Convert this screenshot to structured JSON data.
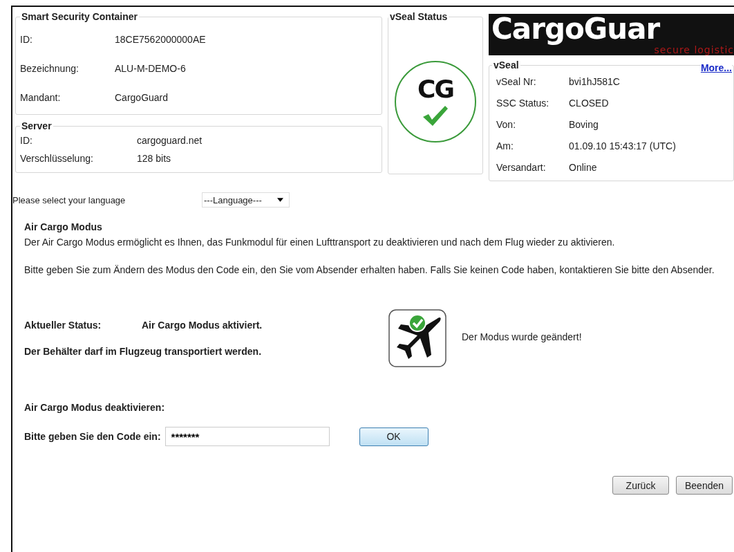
{
  "containers": [
    {
      "title": "Smart Security Container",
      "kind": "wide",
      "rows": [
        {
          "label": "ID:",
          "value": "18CE7562000000AE"
        },
        {
          "label": "Bezeichnung:",
          "value": "ALU-M-DEMO-6"
        },
        {
          "label": "Mandant:",
          "value": "CargoGuard"
        }
      ]
    },
    {
      "title": "Server",
      "kind": "compact",
      "rows": [
        {
          "label": "ID:",
          "value": "cargoguard.net"
        },
        {
          "label": "Verschlüsselung:",
          "value": "128 bits"
        }
      ]
    }
  ],
  "vseal_status": {
    "title": "vSeal Status",
    "badge": "CG",
    "verified": true
  },
  "logo": {
    "name": "CargoGuar",
    "tagline": "secure logistic"
  },
  "vseal": {
    "title": "vSeal",
    "link": "More...",
    "rows": [
      {
        "label": "vSeal Nr:",
        "value": "bvi1hJ581C"
      },
      {
        "label": "SSC Status:",
        "value": "CLOSED"
      },
      {
        "label": "Von:",
        "value": "Boving"
      },
      {
        "label": "Am:",
        "value": "01.09.10 15:43:17 (UTC)"
      },
      {
        "label": "Versandart:",
        "value": "Online"
      }
    ]
  },
  "language": {
    "label": "Please select your language",
    "value": "---Language---"
  },
  "air_cargo": {
    "title": "Air Cargo Modus",
    "paragraphs": [
      "Der Air Cargo Modus ermöglicht es Ihnen, das Funkmodul für einen Lufttransport zu deaktivieren und nach dem Flug wieder zu aktivieren.",
      "Bitte geben Sie zum Ändern des Modus den Code ein, den Sie vom Absender erhalten haben. Falls Sie keinen Code haben, kontaktieren Sie bitte den Absender."
    ]
  },
  "status": {
    "label": "Aktueller Status:",
    "value": "Air Cargo Modus aktiviert.",
    "note": "Der Behälter darf  im Flugzeug transportiert werden.",
    "message": "Der Modus wurde geändert!",
    "flight_allowed": true
  },
  "deactivate": {
    "title": "Air Cargo Modus deaktivieren:",
    "code_label": "Bitte geben Sie den Code ein:",
    "code_value": "*******",
    "button": "OK"
  },
  "buttons": [
    "Zurück",
    "Beenden"
  ]
}
